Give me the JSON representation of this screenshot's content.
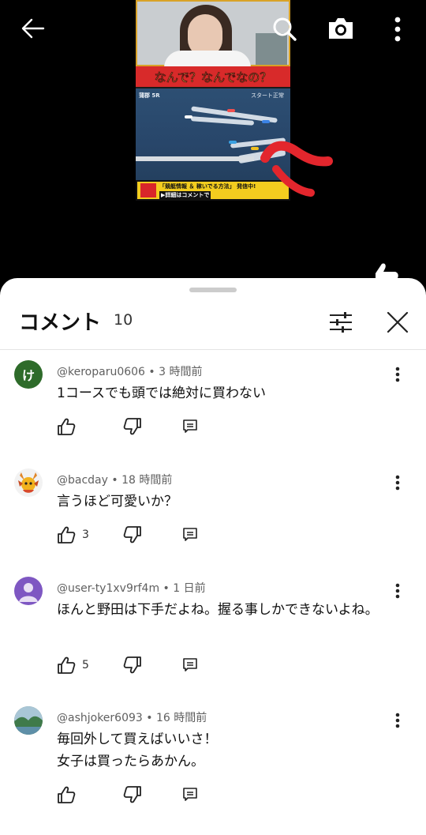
{
  "video": {
    "thumbnail": {
      "banner_text": "なんで？なんでなの？",
      "race_hud_left": "蒲郡 5R",
      "race_hud_right": "スタート正常",
      "bottom_line1": "「競艇情報 ＆ 稼いでる方法」 発信中!",
      "bottom_line2": "▶詳細はコメントで"
    },
    "icons": {
      "back": "arrow-left-icon",
      "search": "search-icon",
      "camera": "camera-icon",
      "more": "more-vert-icon"
    }
  },
  "sheet": {
    "title": "コメント",
    "count": "10",
    "filter_icon": "tune-icon",
    "close_icon": "close-icon"
  },
  "comments": [
    {
      "author": "@keroparu0606",
      "time": "3 時間前",
      "meta": "@keroparu0606 • 3 時間前",
      "text": "1コースでも頭では絶対に買わない",
      "likes": "",
      "avatar_letter": "け",
      "avatar_color": "#2e6b2a"
    },
    {
      "author": "@bacday",
      "time": "18 時間前",
      "meta": "@bacday • 18 時間前",
      "text": "言うほど可愛いか？",
      "likes": "3",
      "avatar_color": "#f2f2f2"
    },
    {
      "author": "@user-ty1xv9rf4m",
      "time": "1 日前",
      "meta": "@user-ty1xv9rf4m • 1 日前",
      "text": "ほんと野田は下手だよね。握る事しかできないよね。",
      "likes": "5",
      "avatar_color": "#7e57c2"
    },
    {
      "author": "@ashjoker6093",
      "time": "16 時間前",
      "meta": "@ashjoker6093 • 16 時間前",
      "text_lines": [
        "毎回外して買えばいいさ！",
        "女子は買ったらあかん。"
      ],
      "likes": "",
      "avatar_color": "#6b8f7a"
    }
  ],
  "action_icons": {
    "like": "thumb-up-icon",
    "dislike": "thumb-down-icon",
    "reply": "reply-icon",
    "more": "more-vert-icon"
  }
}
